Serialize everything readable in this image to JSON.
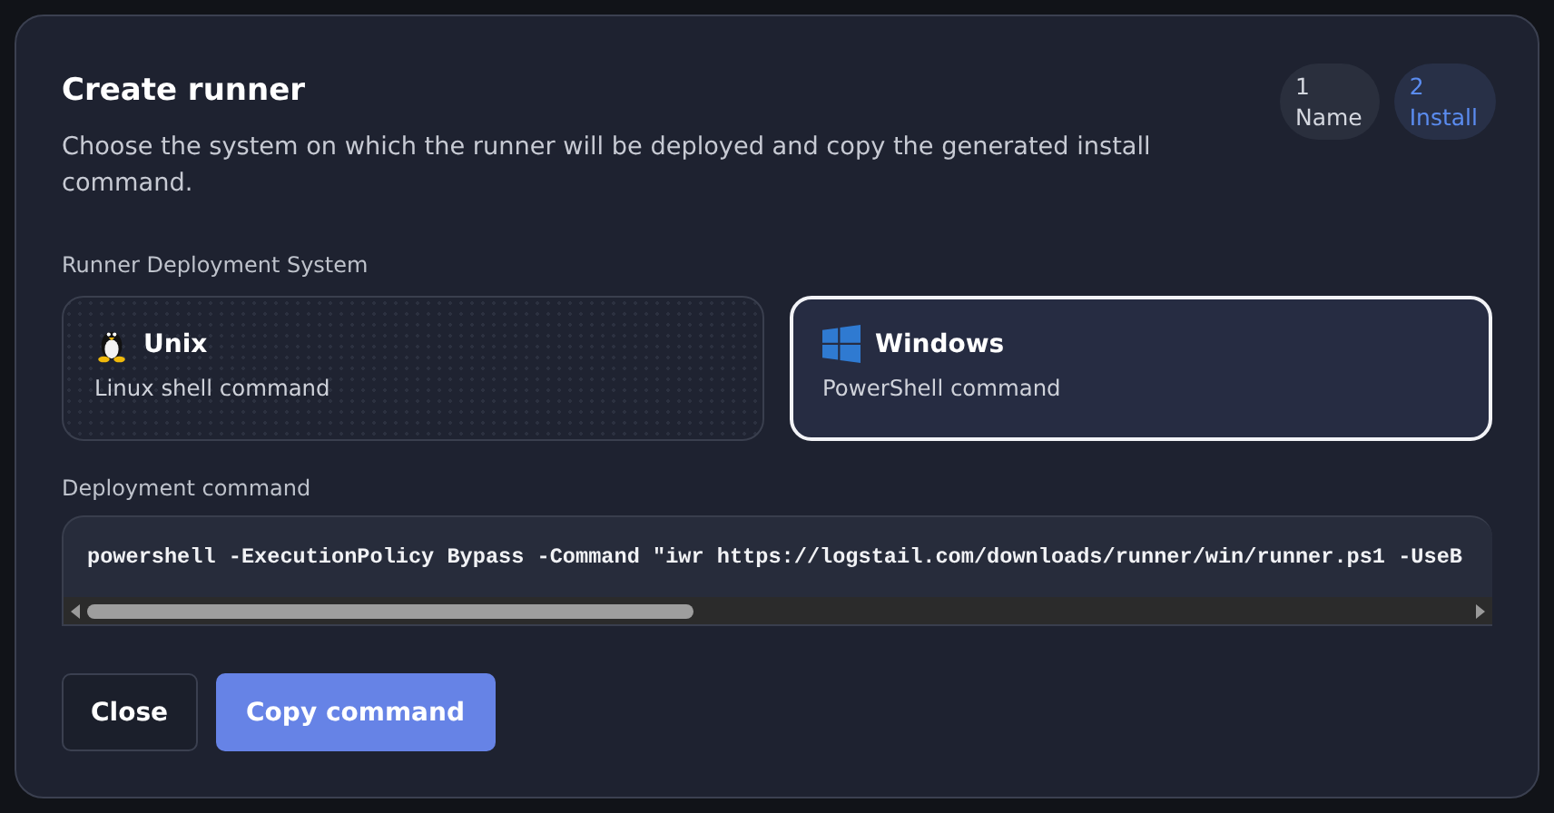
{
  "dialog": {
    "title": "Create runner",
    "description": "Choose the system on which the runner will be deployed and copy the generated install command.",
    "steps": [
      {
        "number": "1",
        "label": "Name",
        "selected": false
      },
      {
        "number": "2",
        "label": "Install",
        "selected": true
      }
    ],
    "system_label": "Runner Deployment System",
    "systems": [
      {
        "kind": "unix",
        "name": "Unix",
        "description": "Linux shell command",
        "selected": false
      },
      {
        "kind": "windows",
        "name": "Windows",
        "description": "PowerShell command",
        "selected": true
      }
    ],
    "command_label": "Deployment command",
    "command": "powershell -ExecutionPolicy Bypass -Command \"iwr https://logstail.com/downloads/runner/win/runner.ps1 -UseB",
    "buttons": [
      {
        "kind": "secondary",
        "label": "Close"
      },
      {
        "kind": "primary",
        "label": "Copy command"
      }
    ]
  }
}
